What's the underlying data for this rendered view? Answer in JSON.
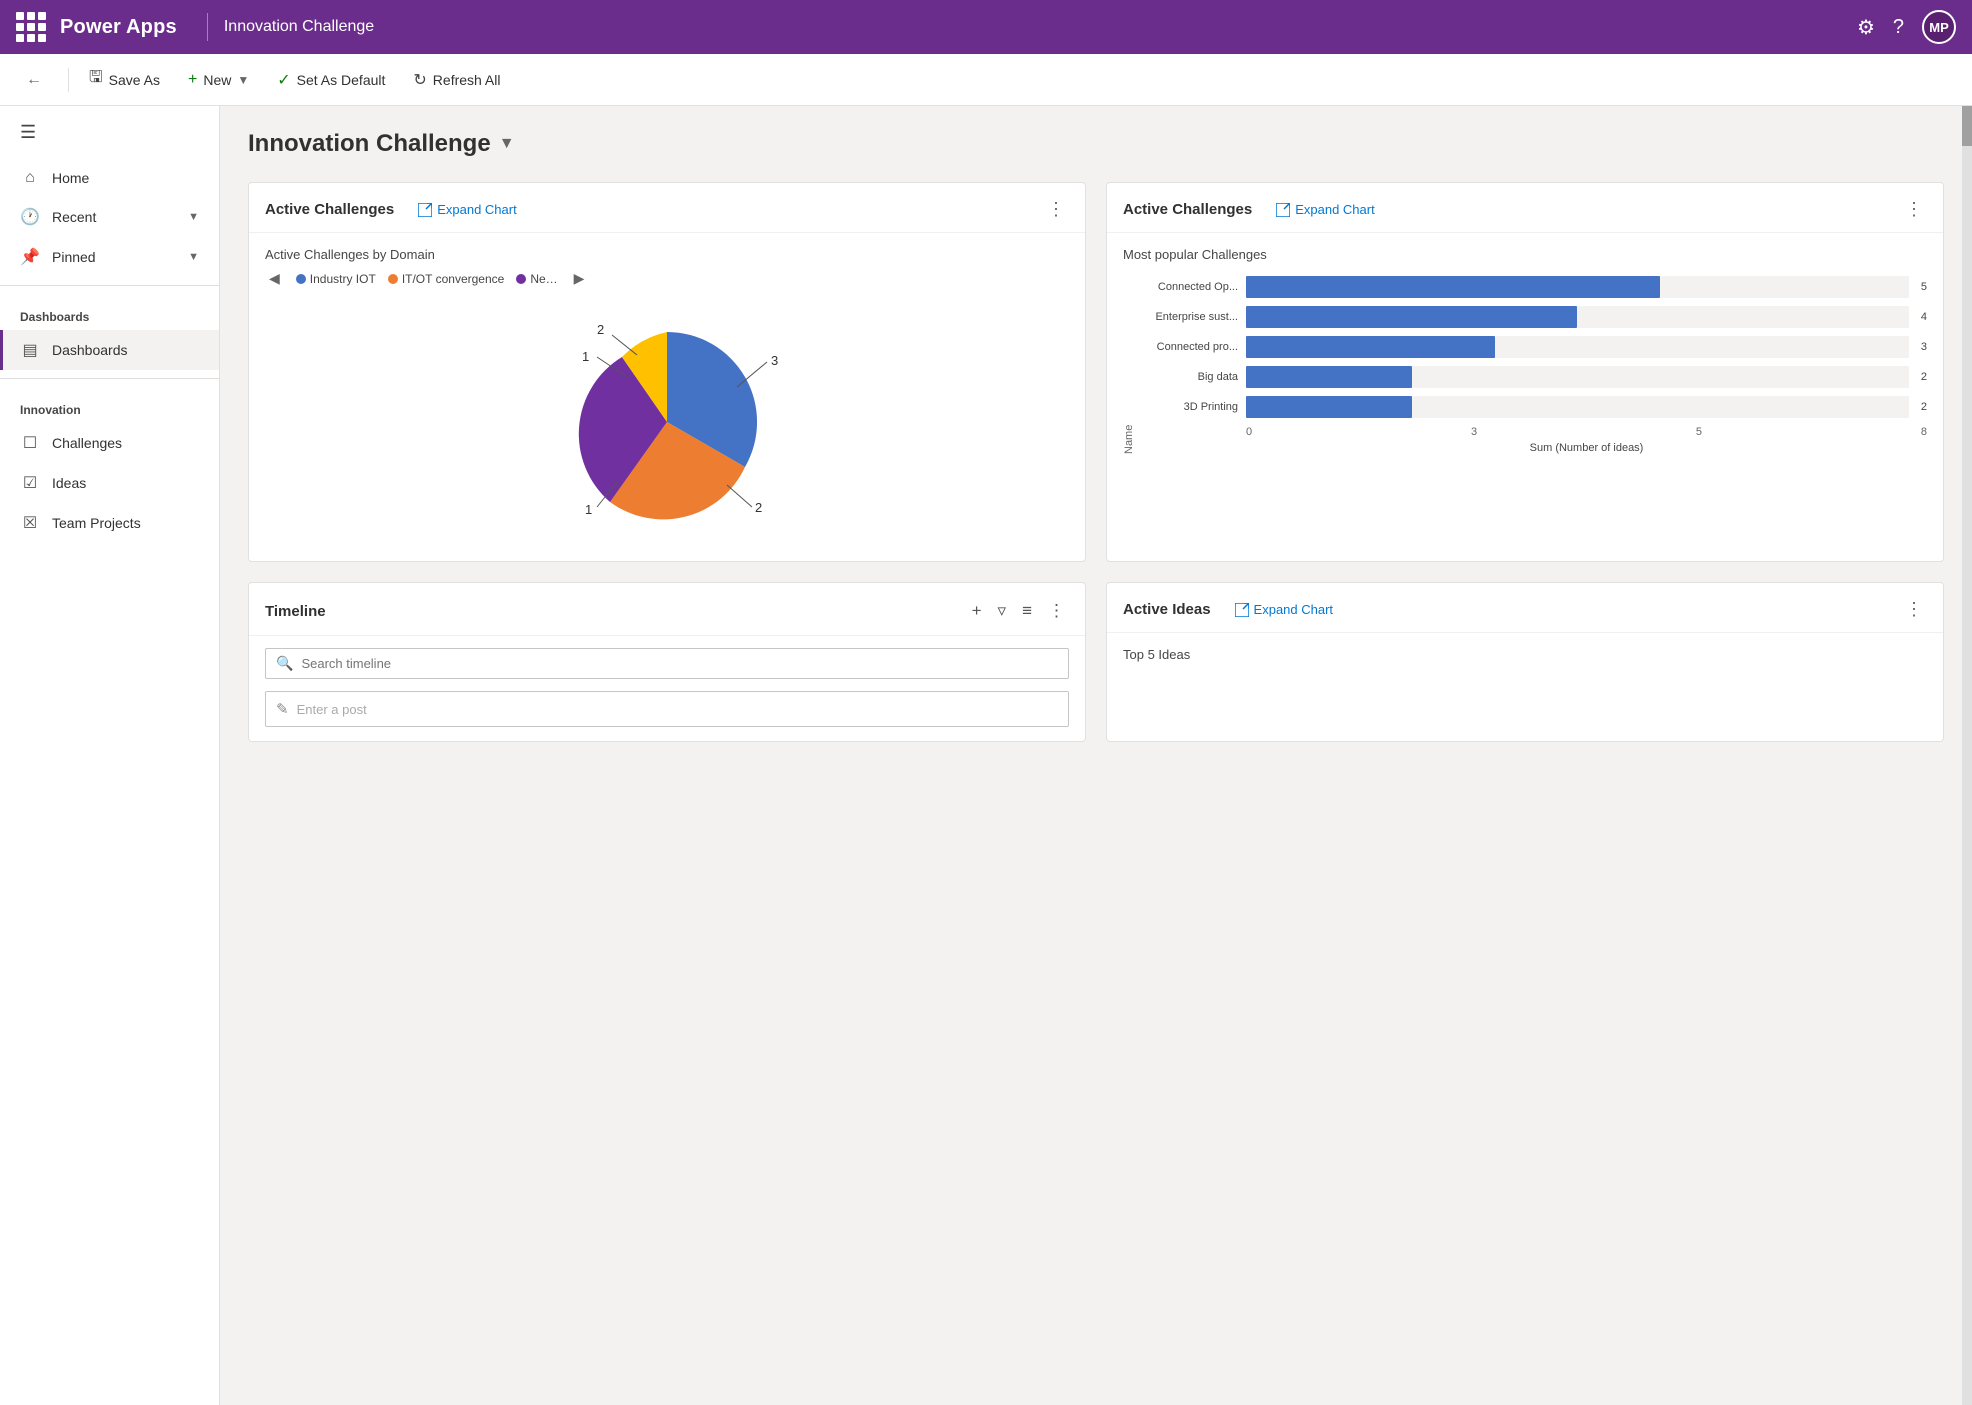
{
  "topnav": {
    "brand": "Power Apps",
    "app_title": "Innovation Challenge",
    "avatar_initials": "MP"
  },
  "toolbar": {
    "back_label": "←",
    "save_as_label": "Save As",
    "new_label": "New",
    "set_default_label": "Set As Default",
    "refresh_all_label": "Refresh All"
  },
  "sidebar": {
    "home_label": "Home",
    "recent_label": "Recent",
    "pinned_label": "Pinned",
    "dashboards_section": "Dashboards",
    "dashboards_item": "Dashboards",
    "innovation_section": "Innovation",
    "challenges_label": "Challenges",
    "ideas_label": "Ideas",
    "team_projects_label": "Team Projects"
  },
  "page": {
    "title": "Innovation Challenge"
  },
  "card1": {
    "title": "Active Challenges",
    "expand_label": "Expand Chart",
    "chart_subtitle": "Active Challenges by Domain",
    "legend": [
      {
        "label": "Industry IOT",
        "color": "#4472C4"
      },
      {
        "label": "IT/OT convergence",
        "color": "#ED7D31"
      },
      {
        "label": "Ne…",
        "color": "#7030A0"
      }
    ],
    "pie_segments": [
      {
        "label": "3",
        "value": 3,
        "color": "#4472C4",
        "startAngle": 0,
        "endAngle": 150
      },
      {
        "label": "2",
        "value": 2,
        "color": "#ED7D31",
        "startAngle": 150,
        "endAngle": 250
      },
      {
        "label": "1",
        "value": 1,
        "color": "#7030A0",
        "startAngle": 250,
        "endAngle": 300
      },
      {
        "label": "1",
        "value": 1,
        "color": "#FFC000",
        "startAngle": 300,
        "endAngle": 360
      },
      {
        "label": "2",
        "value": 2,
        "color": "#A5A5A5",
        "startAngle": 360,
        "endAngle": 450
      }
    ]
  },
  "card2": {
    "title": "Active Challenges",
    "expand_label": "Expand Chart",
    "chart_subtitle": "Most popular Challenges",
    "y_axis_label": "Name",
    "x_axis_label": "Sum (Number of ideas)",
    "x_ticks": [
      "0",
      "3",
      "5",
      "8"
    ],
    "bars": [
      {
        "label": "Connected Op...",
        "value": 5,
        "max": 8
      },
      {
        "label": "Enterprise sust...",
        "value": 4,
        "max": 8
      },
      {
        "label": "Connected pro...",
        "value": 3,
        "max": 8
      },
      {
        "label": "Big data",
        "value": 2,
        "max": 8
      },
      {
        "label": "3D Printing",
        "value": 2,
        "max": 8
      }
    ]
  },
  "card3": {
    "title": "Timeline",
    "search_placeholder": "Search timeline",
    "post_placeholder": "Enter a post"
  },
  "card4": {
    "title": "Active Ideas",
    "expand_label": "Expand Chart",
    "subtitle": "Top 5 Ideas"
  }
}
